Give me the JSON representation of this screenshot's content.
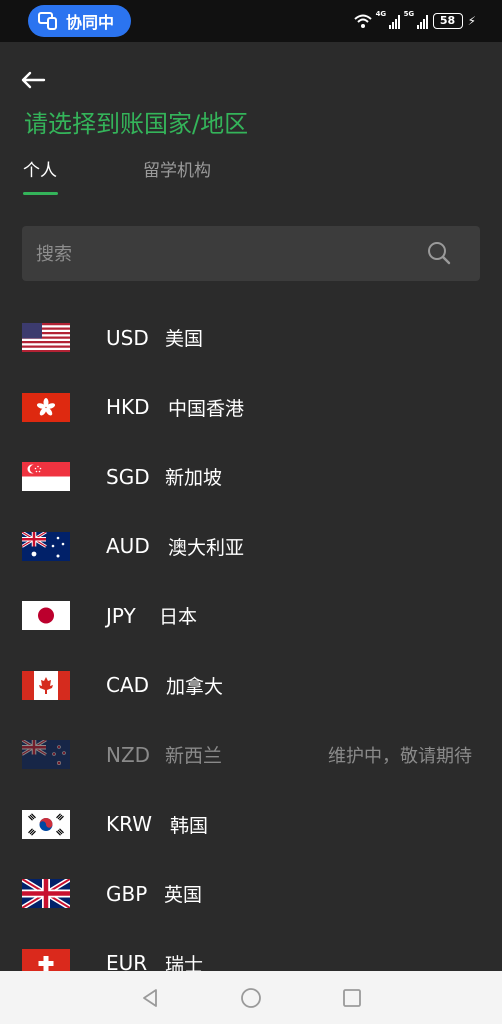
{
  "status_bar": {
    "collab_label": "协同中",
    "network_1": "4G",
    "network_2": "5G",
    "battery": "58"
  },
  "header": {
    "title": "请选择到账国家/地区"
  },
  "tabs": [
    {
      "label": "个人",
      "active": true
    },
    {
      "label": "留学机构",
      "active": false
    }
  ],
  "search": {
    "placeholder": "搜索"
  },
  "currencies": [
    {
      "code": "USD",
      "name": "美国",
      "flag": "us-flag",
      "available": true
    },
    {
      "code": "HKD",
      "name": "中国香港",
      "flag": "hk-flag",
      "available": true
    },
    {
      "code": "SGD",
      "name": "新加坡",
      "flag": "sg-flag",
      "available": true
    },
    {
      "code": "AUD",
      "name": "澳大利亚",
      "flag": "au-flag",
      "available": true
    },
    {
      "code": "JPY",
      "name": "日本",
      "flag": "jp-flag",
      "available": true
    },
    {
      "code": "CAD",
      "name": "加拿大",
      "flag": "ca-flag",
      "available": true
    },
    {
      "code": "NZD",
      "name": "新西兰",
      "flag": "nz-flag",
      "available": false,
      "note": "维护中，敬请期待"
    },
    {
      "code": "KRW",
      "name": "韩国",
      "flag": "kr-flag",
      "available": true
    },
    {
      "code": "GBP",
      "name": "英国",
      "flag": "gb-flag",
      "available": true
    },
    {
      "code": "EUR",
      "name": "瑞士",
      "flag": "ch-flag",
      "available": true
    }
  ],
  "colors": {
    "accent": "#34b45a",
    "background": "#2b2b2b",
    "collab_pill": "#2b74f0"
  }
}
